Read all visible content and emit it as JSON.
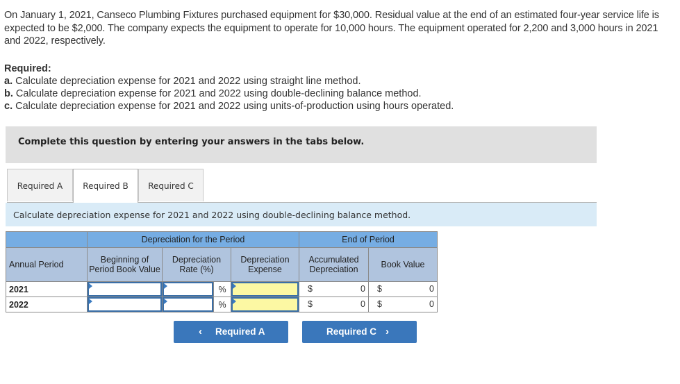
{
  "problem": {
    "intro": "On January 1, 2021, Canseco Plumbing Fixtures purchased equipment for $30,000. Residual value at the end of an estimated four-year service life is expected to be $2,000. The company expects the equipment to operate for 10,000 hours. The equipment operated for 2,200 and 3,000 hours in 2021 and 2022, respectively.",
    "required_title": "Required:",
    "requirements": [
      {
        "letter": "a.",
        "text": " Calculate depreciation expense for 2021 and 2022 using straight line method."
      },
      {
        "letter": "b.",
        "text": " Calculate depreciation expense for 2021 and 2022 using double-declining balance method."
      },
      {
        "letter": "c.",
        "text": " Calculate depreciation expense for 2021 and 2022 using units-of-production using hours operated."
      }
    ]
  },
  "banner": "Complete this question by entering your answers in the tabs below.",
  "tabs": [
    {
      "label": "Required A",
      "active": false
    },
    {
      "label": "Required B",
      "active": true
    },
    {
      "label": "Required C",
      "active": false
    }
  ],
  "instruction": "Calculate depreciation expense for 2021 and 2022 using double-declining balance method.",
  "table": {
    "group_headers": {
      "depreciation": "Depreciation for the Period",
      "end": "End of Period"
    },
    "columns": {
      "period": "Annual Period",
      "beginning": "Beginning of Period Book Value",
      "rate": "Depreciation Rate (%)",
      "expense": "Depreciation Expense",
      "accumulated": "Accumulated Depreciation",
      "book": "Book Value"
    },
    "rows": [
      {
        "year": "2021",
        "beginning": "",
        "rate": "",
        "pct": "%",
        "expense": "",
        "acc_sym": "$",
        "accumulated": "0",
        "book_sym": "$",
        "book": "0"
      },
      {
        "year": "2022",
        "beginning": "",
        "rate": "",
        "pct": "%",
        "expense": "",
        "acc_sym": "$",
        "accumulated": "0",
        "book_sym": "$",
        "book": "0"
      }
    ]
  },
  "nav": {
    "prev_label": "Required A",
    "prev_icon": "‹",
    "next_label": "Required C",
    "next_icon": "›"
  },
  "colors": {
    "accent": "#3a77bb",
    "header_group": "#76ade3",
    "header_sub": "#b0c4de",
    "input_highlight": "#fcf8a3"
  }
}
